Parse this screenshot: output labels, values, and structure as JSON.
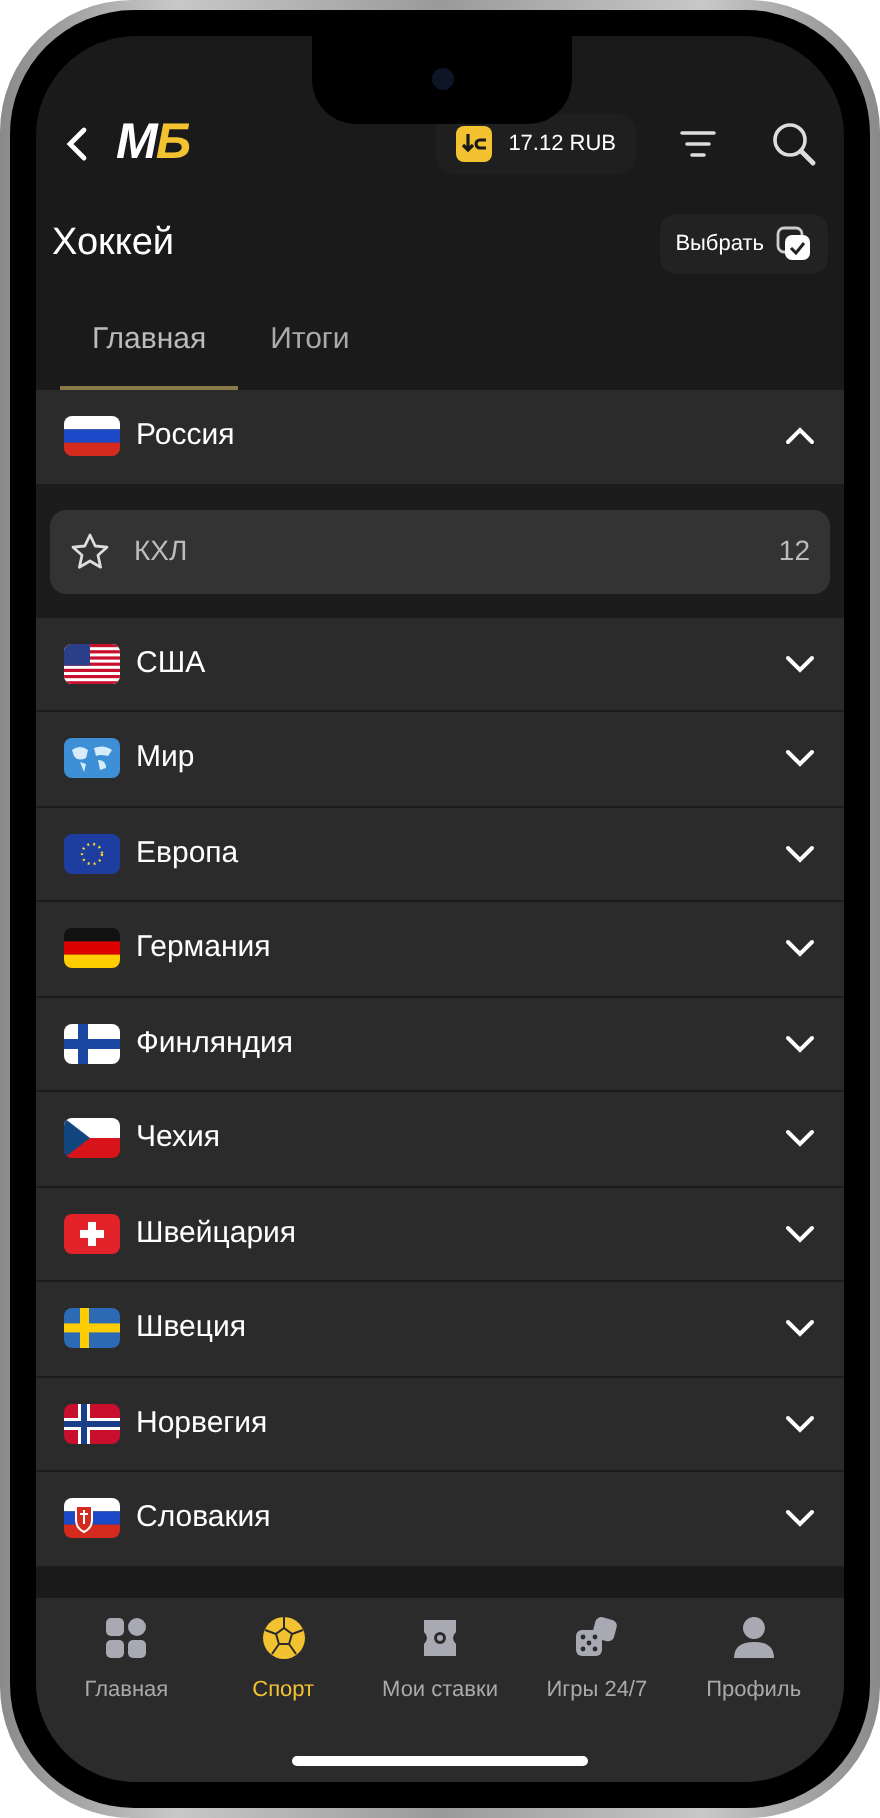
{
  "header": {
    "logo": "МБ",
    "balance": "17.12 RUB"
  },
  "title": "Хоккей",
  "select_button": "Выбрать",
  "tabs": [
    {
      "label": "Главная",
      "selected": true
    },
    {
      "label": "Итоги",
      "selected": false
    }
  ],
  "countries": [
    {
      "name": "Россия",
      "expanded": true,
      "leagues": [
        {
          "name": "КХЛ",
          "count": "12",
          "favorite": false
        }
      ]
    },
    {
      "name": "США",
      "expanded": false
    },
    {
      "name": "Мир",
      "expanded": false
    },
    {
      "name": "Европа",
      "expanded": false
    },
    {
      "name": "Германия",
      "expanded": false
    },
    {
      "name": "Финляндия",
      "expanded": false
    },
    {
      "name": "Чехия",
      "expanded": false
    },
    {
      "name": "Швейцария",
      "expanded": false
    },
    {
      "name": "Швеция",
      "expanded": false
    },
    {
      "name": "Норвегия",
      "expanded": false
    },
    {
      "name": "Словакия",
      "expanded": false
    }
  ],
  "bottom_nav": [
    {
      "label": "Главная",
      "selected": false
    },
    {
      "label": "Спорт",
      "selected": true
    },
    {
      "label": "Мои ставки",
      "selected": false
    },
    {
      "label": "Игры 24/7",
      "selected": false
    },
    {
      "label": "Профиль",
      "selected": false
    }
  ]
}
